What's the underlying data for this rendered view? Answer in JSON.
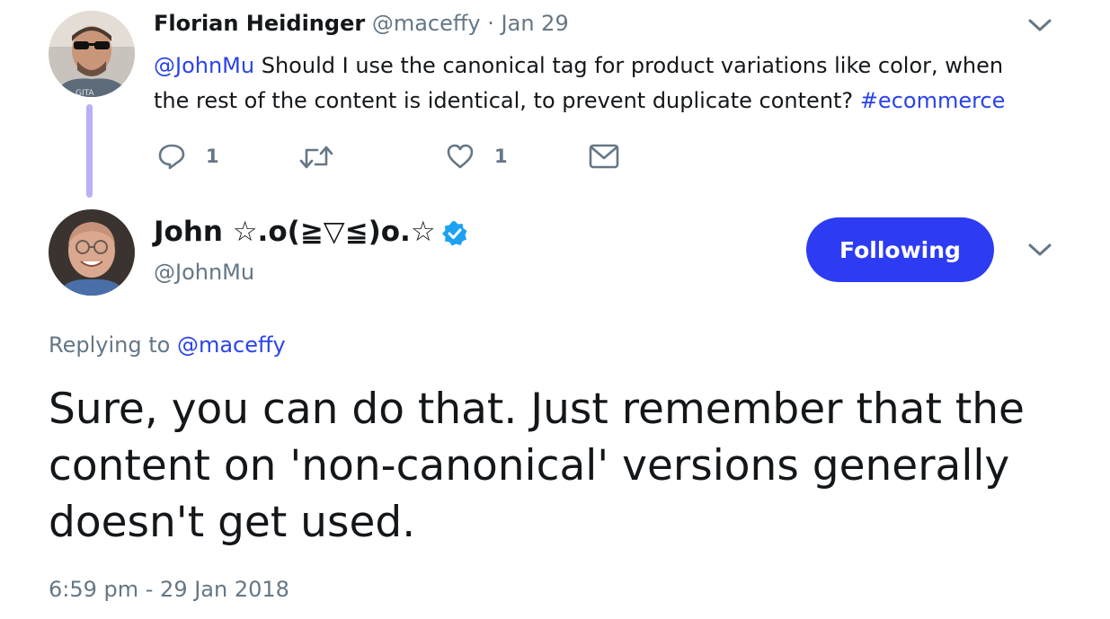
{
  "reply_tweet": {
    "author_name": "Florian Heidinger",
    "author_handle": "@maceffy",
    "separator": "·",
    "date": "Jan 29",
    "mention": "@JohnMu",
    "text_line1": " Should I use the canonical tag for product variations like color, when",
    "text_line2": "the rest of the content is identical, to prevent duplicate content? ",
    "hashtag": "#ecommerce",
    "actions": {
      "reply_count": "1",
      "retweet_count": "",
      "like_count": "1"
    },
    "icons": [
      "reply-icon",
      "retweet-icon",
      "heart-icon",
      "mail-icon",
      "chevron-down-icon"
    ]
  },
  "main_tweet": {
    "author_name": "John ☆.o(≧▽≦)o.☆",
    "author_handle": "@JohnMu",
    "follow_button_label": "Following",
    "replying_prefix": "Replying to ",
    "replying_to": "@maceffy",
    "text_line1": "Sure, you can do that. Just remember that the",
    "text_line2": "content on 'non-canonical' versions generally",
    "text_line3": "doesn't get used.",
    "timestamp": "6:59 pm - 29 Jan 2018"
  },
  "colors": {
    "accent": "#2b43e8",
    "button": "#2d3cf2",
    "verified": "#1da1f2",
    "thread_line": "#b7b1f5",
    "muted": "#657786"
  }
}
